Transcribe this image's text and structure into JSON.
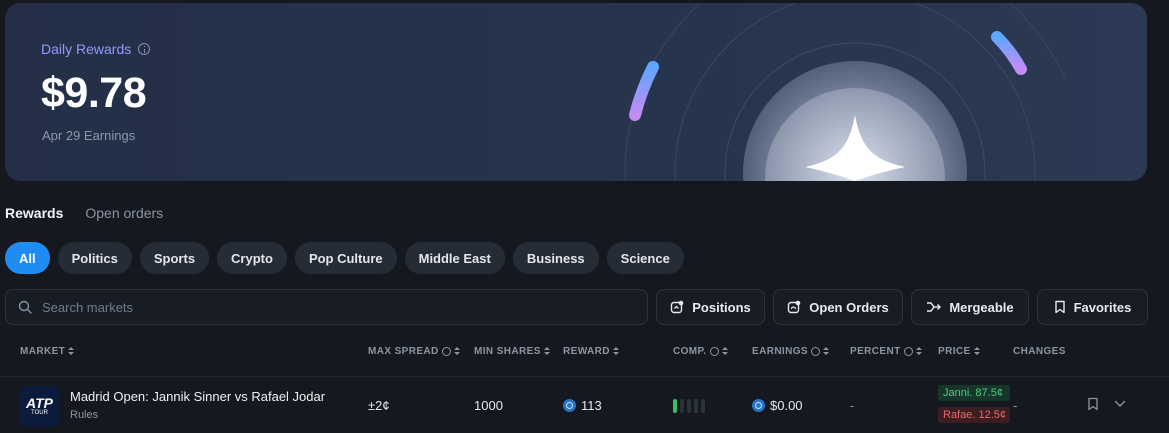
{
  "hero": {
    "title": "Daily Rewards",
    "amount": "$9.78",
    "subtitle": "Apr 29 Earnings"
  },
  "tabs": [
    {
      "label": "Rewards",
      "active": true
    },
    {
      "label": "Open orders",
      "active": false
    }
  ],
  "categories": [
    "All",
    "Politics",
    "Sports",
    "Crypto",
    "Pop Culture",
    "Middle East",
    "Business",
    "Science"
  ],
  "active_category": "All",
  "search": {
    "placeholder": "Search markets"
  },
  "actions": [
    {
      "label": "Positions",
      "icon": "positions-icon"
    },
    {
      "label": "Open Orders",
      "icon": "open-orders-icon"
    },
    {
      "label": "Mergeable",
      "icon": "merge-icon"
    },
    {
      "label": "Favorites",
      "icon": "bookmark-icon"
    }
  ],
  "columns": {
    "market": "MARKET",
    "max_spread": "MAX SPREAD",
    "min_shares": "MIN SHARES",
    "reward": "REWARD",
    "comp": "COMP.",
    "earnings": "EARNINGS",
    "percent": "PERCENT",
    "price": "PRICE",
    "changes": "CHANGES"
  },
  "rows": [
    {
      "logo_text": "ATP",
      "logo_sub": "TOUR",
      "title": "Madrid Open: Jannik Sinner vs Rafael Jodar",
      "rules": "Rules",
      "max_spread": "±2¢",
      "min_shares": "1000",
      "reward": "113",
      "comp_level": 1,
      "comp_total": 5,
      "earnings": "$0.00",
      "percent": "-",
      "price_yes": "Janni. 87.5¢",
      "price_no": "Rafae. 12.5¢",
      "changes": "-"
    }
  ],
  "colors": {
    "accent": "#1e8cf3",
    "hero_bg": "#26324b",
    "yes": "#4ccd7f",
    "no": "#e56a6a"
  }
}
